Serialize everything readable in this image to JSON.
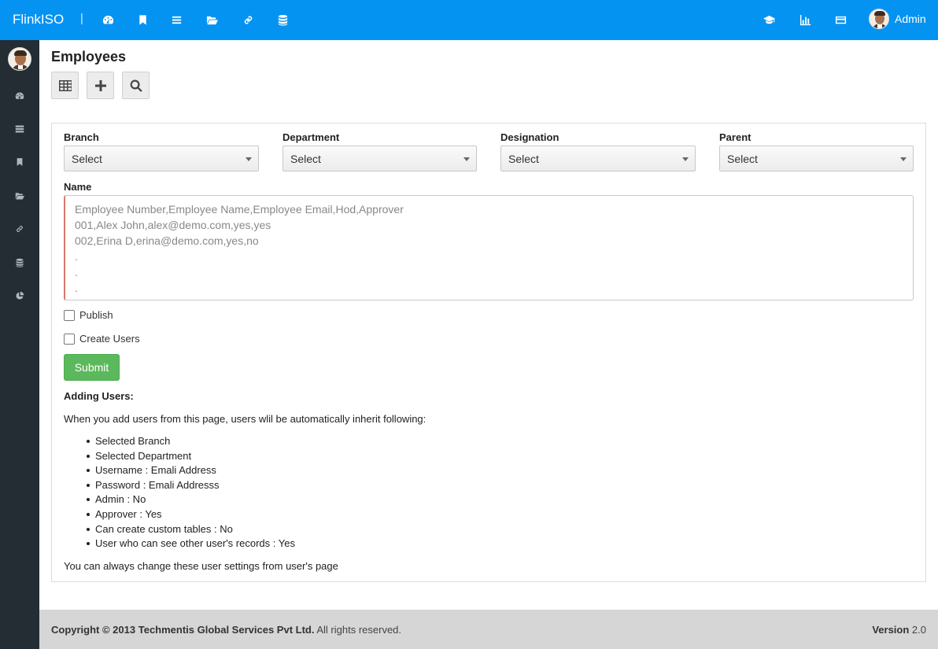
{
  "app": {
    "brand": "FlinkISO",
    "separator": "|",
    "user_name": "Admin"
  },
  "topnav": {
    "left_icons": [
      "dashboard-icon",
      "bookmark-icon",
      "list-icon",
      "folder-open-icon",
      "link-icon",
      "database-icon"
    ],
    "right_icons": [
      "graduation-cap-icon",
      "bar-chart-icon",
      "credit-card-icon"
    ]
  },
  "sidebar": {
    "icons": [
      "dashboard-icon",
      "server-icon",
      "bookmark-icon",
      "folder-open-icon",
      "link-icon",
      "database-icon",
      "pie-chart-icon"
    ]
  },
  "page": {
    "title": "Employees",
    "toolbar": [
      "table-icon",
      "plus-icon",
      "search-icon"
    ]
  },
  "form": {
    "branch": {
      "label": "Branch",
      "value": "Select"
    },
    "department": {
      "label": "Department",
      "value": "Select"
    },
    "designation": {
      "label": "Designation",
      "value": "Select"
    },
    "parent": {
      "label": "Parent",
      "value": "Select"
    },
    "name": {
      "label": "Name",
      "placeholder": "Employee Number,Employee Name,Employee Email,Hod,Approver\n001,Alex John,alex@demo.com,yes,yes\n002,Erina D,erina@demo.com,yes,no\n.\n.\n."
    },
    "publish_label": "Publish",
    "create_users_label": "Create Users",
    "submit_label": "Submit"
  },
  "info": {
    "title": "Adding Users:",
    "intro": "When you add users from this page, users wlil be automatically inherit following:",
    "items": [
      "Selected Branch",
      "Selected Department",
      "Username : Emali Address",
      "Password : Emali Addresss",
      "Admin : No",
      "Approver : Yes",
      "Can create custom tables : No",
      "User who can see other user's records : Yes"
    ],
    "footer": "You can always change these user settings from user's page"
  },
  "footer": {
    "copyright_prefix": "Copyright © 2013",
    "company": "Techmentis Global Services Pvt Ltd.",
    "rights": "All rights reserved.",
    "version_label": "Version",
    "version_value": "2.0"
  },
  "colors": {
    "topbar": "#0593f2",
    "sidebar": "#232d33",
    "submit": "#5cb85c",
    "footer": "#d6d6d6"
  }
}
